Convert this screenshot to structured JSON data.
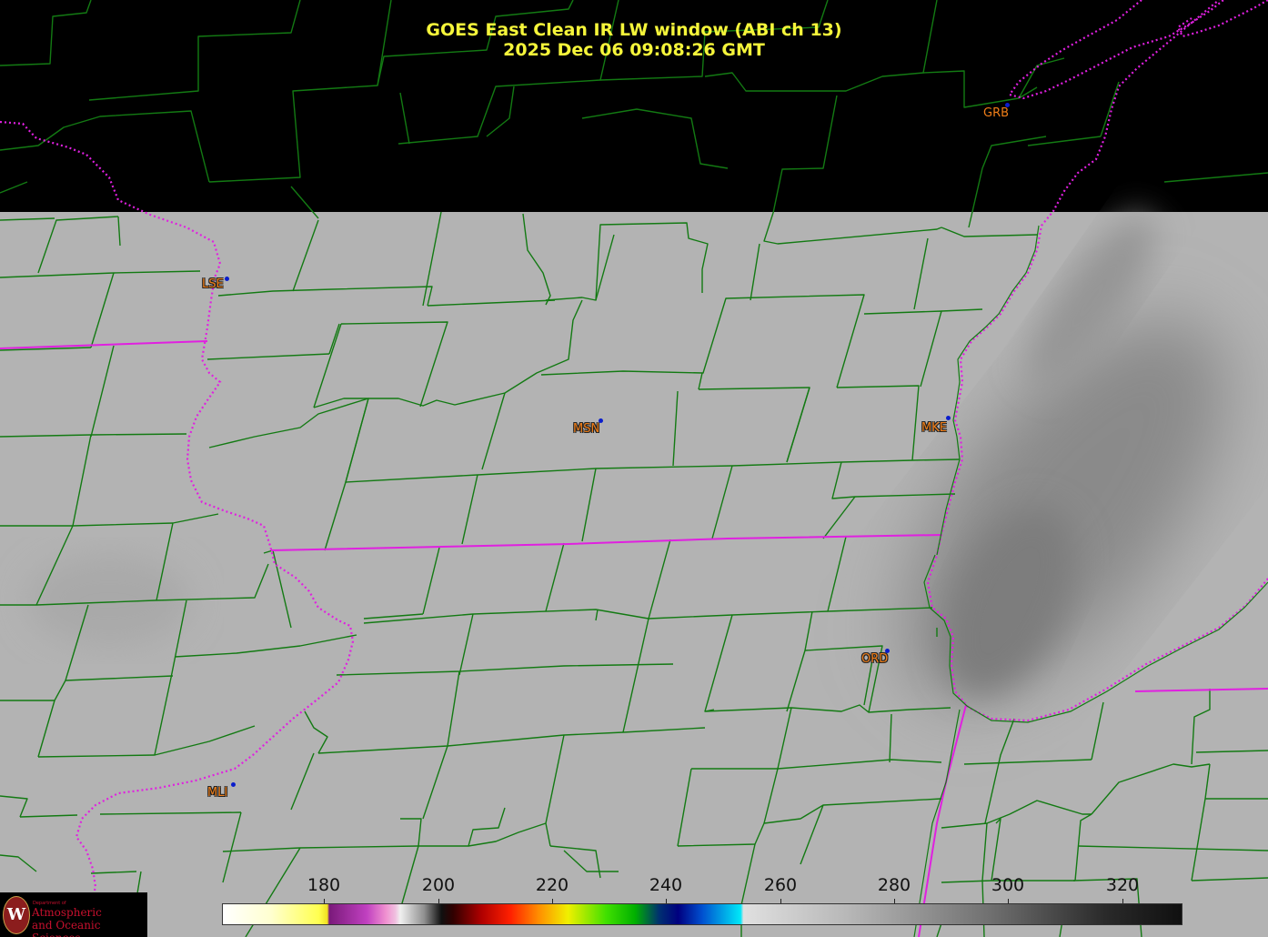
{
  "title": {
    "line1": "GOES East Clean IR LW window (ABI ch 13)",
    "line2": "2025 Dec 06  09:08:26 GMT"
  },
  "stations": [
    {
      "id": "lse",
      "label": "LSE"
    },
    {
      "id": "msn",
      "label": "MSN"
    },
    {
      "id": "mke",
      "label": "MKE"
    },
    {
      "id": "ord",
      "label": "ORD"
    },
    {
      "id": "mli",
      "label": "MLI"
    },
    {
      "id": "grb",
      "label": "GRB"
    }
  ],
  "colorbar": {
    "ticks": [
      "180",
      "200",
      "220",
      "240",
      "260",
      "280",
      "300",
      "320"
    ]
  },
  "logo": {
    "dept_label": "Department of",
    "line1": "Atmospheric",
    "line2": "and Oceanic Sciences",
    "seal_letter": "W"
  },
  "colors": {
    "title": "#f5f53a",
    "county_border": "#137a13",
    "state_border": "#e020e0",
    "station_label": "#f07e18",
    "station_dot": "#0a1dcc",
    "cloud_gray": "#b4b4b4",
    "no_data": "#000000"
  }
}
